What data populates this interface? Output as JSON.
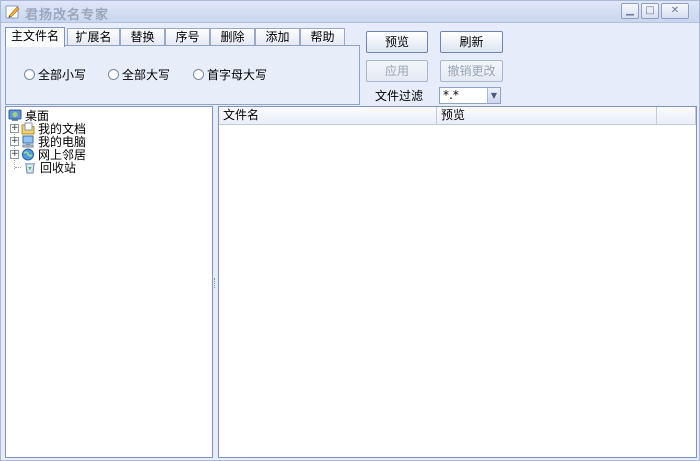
{
  "window": {
    "title": "君扬改名专家"
  },
  "tabs": [
    {
      "label": "主文件名",
      "active": true
    },
    {
      "label": "扩展名"
    },
    {
      "label": "替换"
    },
    {
      "label": "序号"
    },
    {
      "label": "删除"
    },
    {
      "label": "添加"
    },
    {
      "label": "帮助"
    }
  ],
  "case_options": [
    {
      "label": "全部小写"
    },
    {
      "label": "全部大写"
    },
    {
      "label": "首字母大写"
    }
  ],
  "buttons": {
    "preview": "预览",
    "refresh": "刷新",
    "apply": "应用",
    "undo": "撤销更改"
  },
  "filter": {
    "label": "文件过滤",
    "value": "*.*"
  },
  "tree": {
    "root": "桌面",
    "items": [
      {
        "label": "我的文档",
        "icon": "documents-icon"
      },
      {
        "label": "我的电脑",
        "icon": "computer-icon"
      },
      {
        "label": "网上邻居",
        "icon": "network-icon"
      },
      {
        "label": "回收站",
        "icon": "recycle-bin-icon"
      }
    ]
  },
  "list": {
    "columns": [
      "文件名",
      "预览"
    ]
  },
  "colors": {
    "accent": "#7f93bb",
    "window_bg": "#e6ecf9"
  }
}
